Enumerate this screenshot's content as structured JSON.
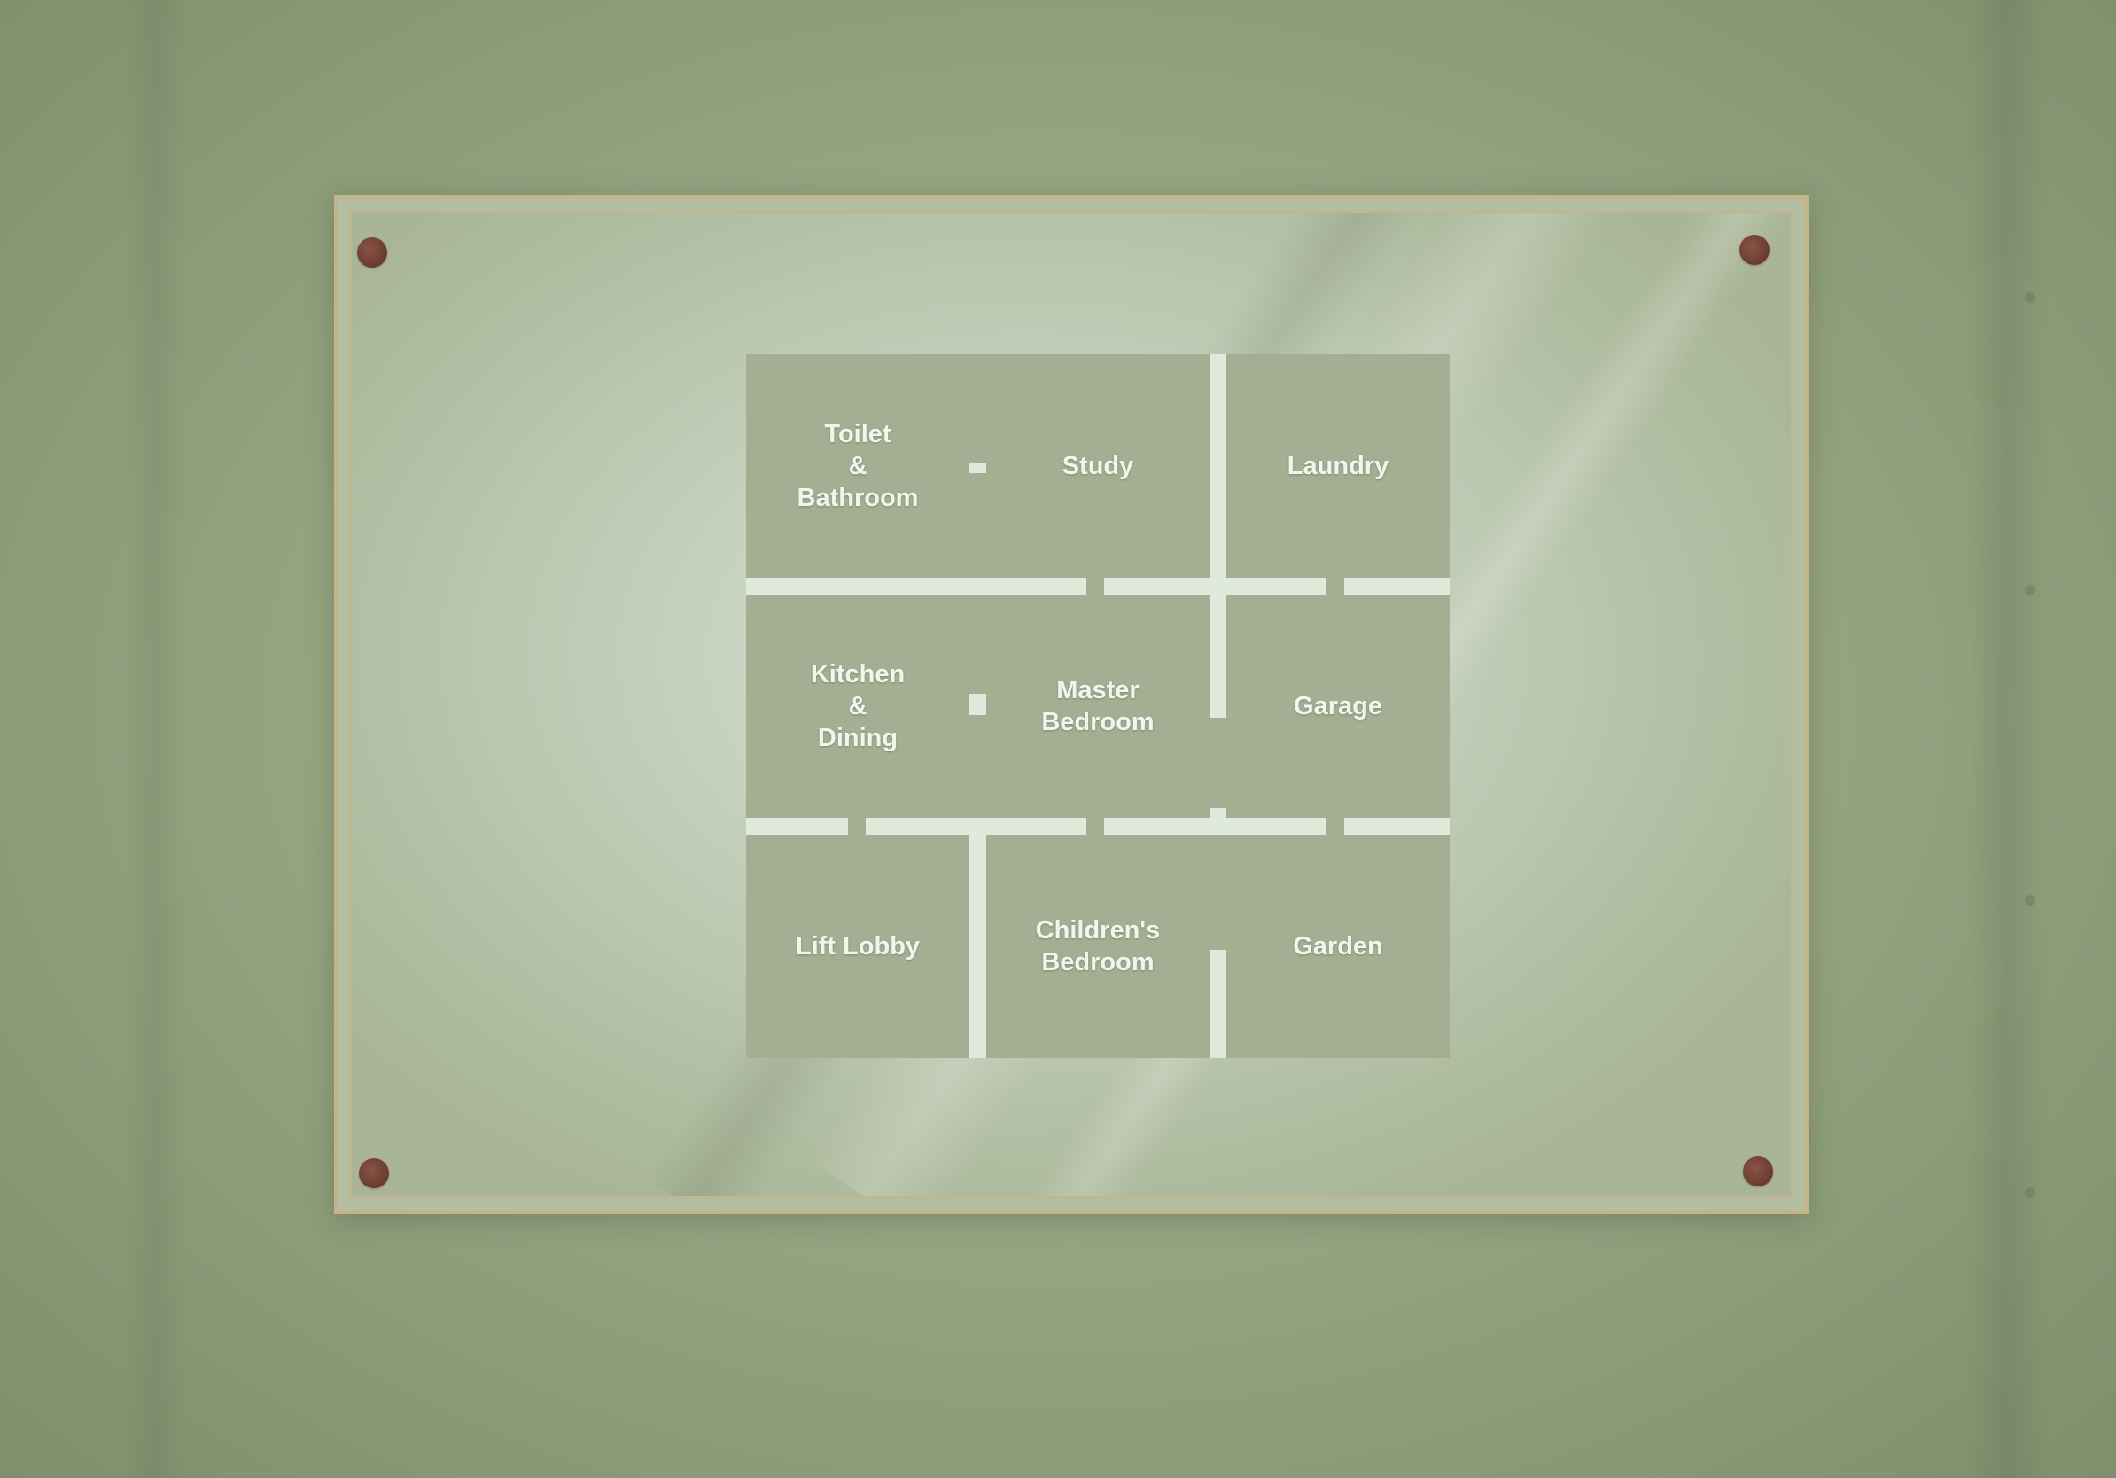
{
  "floor_plan": {
    "rooms": [
      {
        "id": "toilet-bathroom",
        "label": "Toilet\n&\nBathroom"
      },
      {
        "id": "study",
        "label": "Study"
      },
      {
        "id": "laundry",
        "label": "Laundry"
      },
      {
        "id": "kitchen-dining",
        "label": "Kitchen\n&\nDining"
      },
      {
        "id": "master-bedroom",
        "label": "Master\nBedroom"
      },
      {
        "id": "garage",
        "label": "Garage"
      },
      {
        "id": "lift-lobby",
        "label": "Lift Lobby"
      },
      {
        "id": "childrens-bedroom",
        "label": "Children's\nBedroom"
      },
      {
        "id": "garden",
        "label": "Garden"
      }
    ]
  },
  "colors": {
    "wall": "#8c9a79",
    "frame": "#c4b48a",
    "room_fill": "#a4ae93",
    "corridor": "#dfe9dc",
    "screw": "#6b3b30"
  }
}
